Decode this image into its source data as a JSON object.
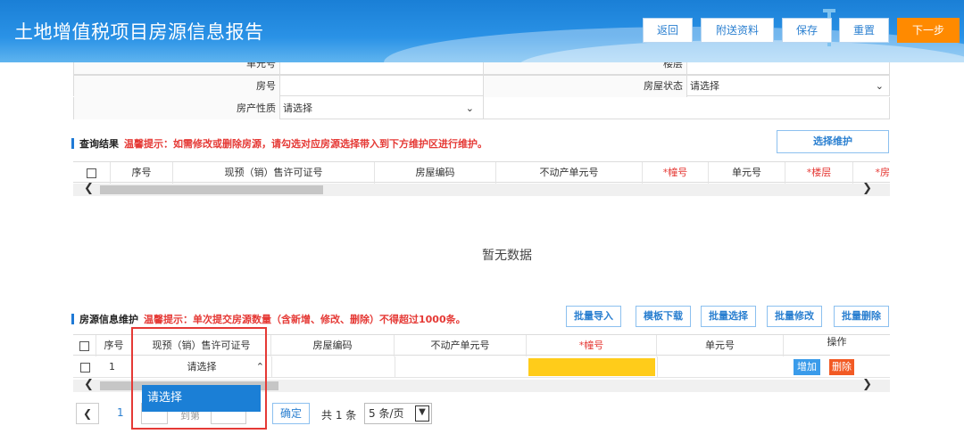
{
  "header": {
    "title": "土地增值税项目房源信息报告",
    "buttons": {
      "back": "返回",
      "attach": "附送资料",
      "save": "保存",
      "reset": "重置",
      "next": "下一步"
    }
  },
  "form": {
    "unit_no_label": "单元号",
    "floor_label": "楼层",
    "room_no_label": "房号",
    "room_no_value": "",
    "house_status_label": "房屋状态",
    "house_status_value": "请选择",
    "property_nature_label": "房产性质",
    "property_nature_value": "请选择"
  },
  "query_result": {
    "title": "查询结果",
    "tip": "温馨提示：如需修改或删除房源，请勾选对应房源选择带入到下方维护区进行维护。",
    "select_button": "选择维护",
    "columns": [
      "序号",
      "现预（销）售许可证号",
      "房屋编码",
      "不动产单元号",
      "*幢号",
      "单元号",
      "*楼层",
      "*房"
    ],
    "empty_text": "暂无数据"
  },
  "maintenance": {
    "title": "房源信息维护",
    "tip": "温馨提示：单次提交房源数量（含新增、修改、删除）不得超过1000条。",
    "buttons": {
      "import": "批量导入",
      "template": "模板下载",
      "batch_select": "批量选择",
      "batch_edit": "批量修改",
      "batch_delete": "批量删除"
    },
    "columns": [
      "序号",
      "现预（销）售许可证号",
      "房屋编码",
      "不动产单元号",
      "*幢号",
      "单元号",
      "操作"
    ],
    "row": {
      "index": "1",
      "permit_value": "请选择",
      "add": "增加",
      "delete": "删除"
    },
    "dropdown_option": "请选择"
  },
  "pager": {
    "page": "1",
    "goto_label": "到第",
    "confirm": "确定",
    "total": "共 1 条",
    "per_page": "5 条/页"
  }
}
